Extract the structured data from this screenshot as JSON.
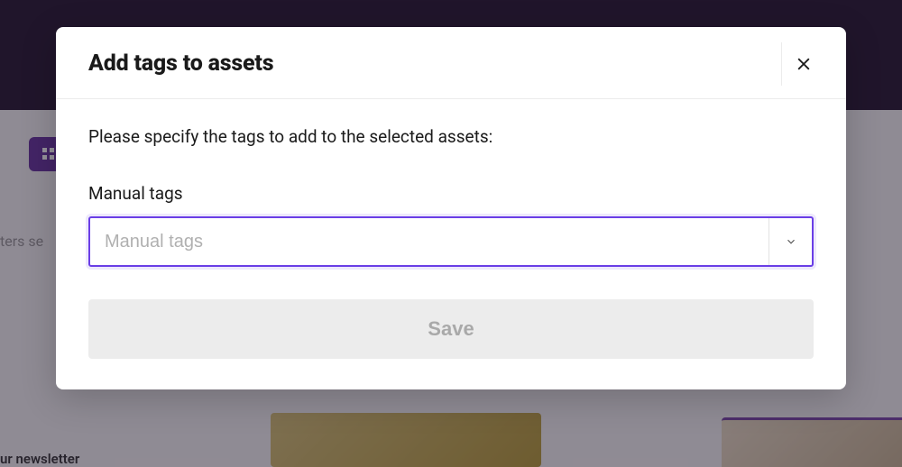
{
  "backdrop": {
    "filters_text": "ters se",
    "newsletter_text": "ur newsletter"
  },
  "modal": {
    "title": "Add tags to assets",
    "instruction": "Please specify the tags to add to the selected assets:",
    "field_label": "Manual tags",
    "input_placeholder": "Manual tags",
    "input_value": "",
    "save_label": "Save"
  }
}
